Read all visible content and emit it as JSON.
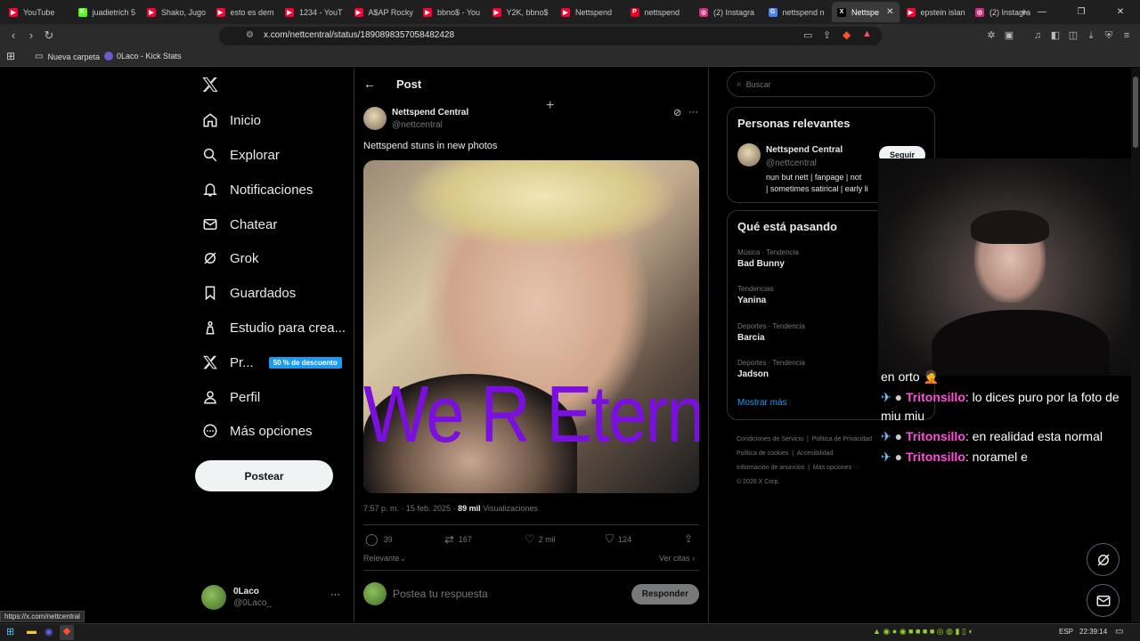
{
  "browser": {
    "tabs": [
      {
        "label": "YouTube",
        "color": "#ff0033",
        "glyph": "▶"
      },
      {
        "label": "juadietrich 5",
        "color": "#53fc18",
        "glyph": "K"
      },
      {
        "label": "Shako, Jugo",
        "color": "#ff0033",
        "glyph": "▶"
      },
      {
        "label": "esto es dem",
        "color": "#ff0033",
        "glyph": "▶"
      },
      {
        "label": "1234 - YouT",
        "color": "#ff0033",
        "glyph": "▶"
      },
      {
        "label": "A$AP Rocky",
        "color": "#ff0033",
        "glyph": "▶"
      },
      {
        "label": "bbno$ - You",
        "color": "#ff0033",
        "glyph": "▶"
      },
      {
        "label": "Y2K, bbno$",
        "color": "#ff0033",
        "glyph": "▶"
      },
      {
        "label": "Nettspend",
        "color": "#ff0033",
        "glyph": "▶"
      },
      {
        "label": "nettspend",
        "color": "#e60023",
        "glyph": "P"
      },
      {
        "label": "(2) Instagra",
        "color": "#d62976",
        "glyph": "◎"
      },
      {
        "label": "nettspend n",
        "color": "#4285f4",
        "glyph": "G"
      },
      {
        "label": "Nettspe",
        "color": "#000000",
        "glyph": "X",
        "active": true,
        "close": "✕"
      },
      {
        "label": "epstein islan",
        "color": "#ff0033",
        "glyph": "▶"
      },
      {
        "label": "(2) Instagra",
        "color": "#d62976",
        "glyph": "◎"
      }
    ],
    "new_tab": "+",
    "url": "x.com/nettcentral/status/1890898357058482428",
    "bookmarks": [
      {
        "label": "Nueva carpeta",
        "icon": "folder-icon"
      },
      {
        "label": "0Laco - Kick Stats",
        "icon": "kick-stats-icon"
      }
    ],
    "status_url": "https://x.com/nettcentral"
  },
  "x": {
    "nav": [
      {
        "label": "Inicio",
        "icon": "home-icon"
      },
      {
        "label": "Explorar",
        "icon": "search-icon"
      },
      {
        "label": "Notificaciones",
        "icon": "bell-icon"
      },
      {
        "label": "Chatear",
        "icon": "mail-icon"
      },
      {
        "label": "Grok",
        "icon": "grok-icon"
      },
      {
        "label": "Guardados",
        "icon": "bookmark-icon"
      },
      {
        "label": "Estudio para crea...",
        "icon": "studio-icon"
      },
      {
        "label": "Pr...",
        "icon": "x-logo-icon",
        "badge": "50 % de descuento"
      },
      {
        "label": "Perfil",
        "icon": "person-icon"
      },
      {
        "label": "Más opciones",
        "icon": "more-circle-icon"
      }
    ],
    "post_button": "Postear",
    "account": {
      "name": "0Laco",
      "handle": "@0Laco_",
      "more": "···"
    },
    "header_title": "Post",
    "post": {
      "author": "Nettspend Central",
      "handle": "@nettcentral",
      "text": "Nettspend stuns in new photos",
      "image_overlay": "We R Eternal",
      "time": "7:57 p. m. · 15 feb. 2025 ·",
      "views_count": "89 mil",
      "views_label": "Visualizaciones",
      "replies": "39",
      "reposts": "167",
      "likes": "2 mil",
      "bookmarks": "124",
      "sort": "Relevante",
      "quotes": "Ver citas"
    },
    "reply": {
      "placeholder": "Postea tu respuesta",
      "button": "Responder"
    },
    "search_placeholder": "Buscar",
    "relevant": {
      "title": "Personas relevantes",
      "name": "Nettspend Central",
      "handle": "@nettcentral",
      "bio_line1": "nun but nett | fanpage | not",
      "bio_line2": "| sometimes satirical | early li",
      "follow": "Seguir"
    },
    "trends": {
      "title": "Qué está pasando",
      "items": [
        {
          "category": "Música · Tendencia",
          "name": "Bad Bunny"
        },
        {
          "category": "Tendencias",
          "name": "Yanina"
        },
        {
          "category": "Deportes · Tendencia",
          "name": "Barcia"
        },
        {
          "category": "Deportes · Tendencia",
          "name": "Jadson"
        }
      ],
      "show_more": "Mostrar más"
    },
    "footer": {
      "row1": [
        "Condiciones de Servicio",
        "Política de Privacidad"
      ],
      "row2": [
        "Política de cookies",
        "Accesibilidad"
      ],
      "row3": [
        "Información de anuncios",
        "Más opciones ···"
      ],
      "copyright": "© 2026 X Corp."
    }
  },
  "overlay_chat": [
    {
      "user": "",
      "text": "en orto 🤦"
    },
    {
      "user": "Tritonsillo",
      "text": ": lo dices puro por la foto de"
    },
    {
      "user": "",
      "text": "miu miu"
    },
    {
      "user": "Tritonsillo",
      "text": ": en realidad esta normal"
    },
    {
      "user": "Tritonsillo",
      "text": ": noramel e"
    }
  ],
  "taskbar": {
    "lang": "ESP",
    "time": "22:39:14"
  }
}
